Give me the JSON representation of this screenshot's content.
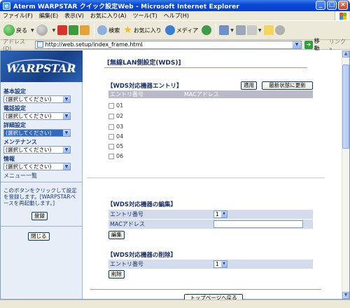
{
  "window": {
    "title": "Aterm WARPSTAR クイック設定Web - Microsoft Internet Explorer"
  },
  "menubar": [
    "ファイル(F)",
    "編集(E)",
    "表示(V)",
    "お気に入り(A)",
    "ツール(T)",
    "ヘルプ(H)"
  ],
  "toolbar": {
    "back_label": "戻る",
    "search_label": "検索",
    "favorites_label": "お気に入り",
    "media_label": "メディア"
  },
  "address": {
    "label": "アドレス(D)",
    "url": "http://web.setup/index_frame.html",
    "go_label": "移動",
    "links_label": "リンク »"
  },
  "sidebar": {
    "logo_text": "WARPSTAR",
    "sections": [
      {
        "label": "基本設定",
        "value": "(選択してください)"
      },
      {
        "label": "電話設定",
        "value": "(選択してください)"
      },
      {
        "label": "詳細設定",
        "value": "(選択してください)"
      },
      {
        "label": "メンテナンス",
        "value": "(選択してください)"
      },
      {
        "label": "情報",
        "value": "(選択してください)"
      }
    ],
    "menu_list_label": "メニュー一覧",
    "note": "このボタンをクリックして設定を登録します。[WARPSTARベースを再起動します。]",
    "register_button": "登録",
    "close_button": "閉じる"
  },
  "main": {
    "page_title": "[無線LAN側設定(WDS)]",
    "entries_section": {
      "title": "【WDS対応機器エントリ】",
      "apply_button": "適用",
      "refresh_button": "最新状態に更新",
      "col_entry": "エントリ番号",
      "col_mac": "MACアドレス",
      "entries": [
        "01",
        "02",
        "03",
        "04",
        "05",
        "06"
      ]
    },
    "edit_section": {
      "title": "【WDS対応機器の編集】",
      "entry_label": "エントリ番号",
      "entry_value": "1",
      "mac_label": "MACアドレス",
      "mac_value": "",
      "edit_button": "編集"
    },
    "delete_section": {
      "title": "【WDS対応機器の削除】",
      "entry_label": "エントリ番号",
      "entry_value": "1",
      "delete_button": "削除"
    },
    "top_button": "トップページへ戻る"
  }
}
